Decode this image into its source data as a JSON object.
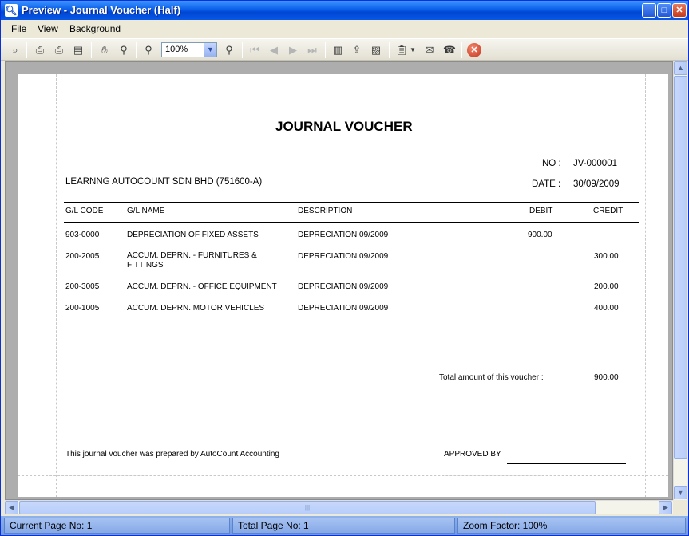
{
  "window": {
    "title": "Preview - Journal Voucher (Half)"
  },
  "menu": {
    "file": "File",
    "view": "View",
    "background": "Background"
  },
  "toolbar": {
    "zoom_value": "100%"
  },
  "voucher": {
    "title": "JOURNAL VOUCHER",
    "no_label": "NO :",
    "no_value": "JV-000001",
    "date_label": "DATE :",
    "date_value": "30/09/2009",
    "company": "LEARNNG AUTOCOUNT SDN BHD (751600-A)",
    "columns": {
      "gl_code": "G/L CODE",
      "gl_name": "G/L NAME",
      "description": "DESCRIPTION",
      "debit": "DEBIT",
      "credit": "CREDIT"
    },
    "rows": [
      {
        "code": "903-0000",
        "name1": "DEPRECIATION OF FIXED ASSETS",
        "name2": "",
        "desc": "DEPRECIATION 09/2009",
        "debit": "900.00",
        "credit": ""
      },
      {
        "code": "200-2005",
        "name1": "ACCUM. DEPRN. - FURNITURES &",
        "name2": "FITTINGS",
        "desc": "DEPRECIATION 09/2009",
        "debit": "",
        "credit": "300.00"
      },
      {
        "code": "200-3005",
        "name1": "ACCUM. DEPRN. - OFFICE EQUIPMENT",
        "name2": "",
        "desc": "DEPRECIATION 09/2009",
        "debit": "",
        "credit": "200.00"
      },
      {
        "code": "200-1005",
        "name1": "ACCUM. DEPRN. MOTOR VEHICLES",
        "name2": "",
        "desc": "DEPRECIATION 09/2009",
        "debit": "",
        "credit": "400.00"
      }
    ],
    "total_label": "Total amount of this voucher :",
    "total_value": "900.00",
    "footer_note": "This journal voucher was prepared by AutoCount Accounting",
    "approved_by": "APPROVED BY"
  },
  "status": {
    "current_page": "Current Page No: 1",
    "total_page": "Total Page No: 1",
    "zoom": "Zoom Factor: 100%"
  },
  "icons": [
    "binoculars-icon",
    "printer-setup-icon",
    "printer-icon",
    "print-preview-icon",
    "hand-icon",
    "zoom-icon",
    "zoom-out-icon",
    "zoom-in-icon",
    "first-page-icon",
    "prev-page-icon",
    "next-page-icon",
    "last-page-icon",
    "page-setup-icon",
    "export-icon",
    "design-icon",
    "clipboard-icon",
    "email-icon",
    "fax-icon",
    "close-icon"
  ]
}
